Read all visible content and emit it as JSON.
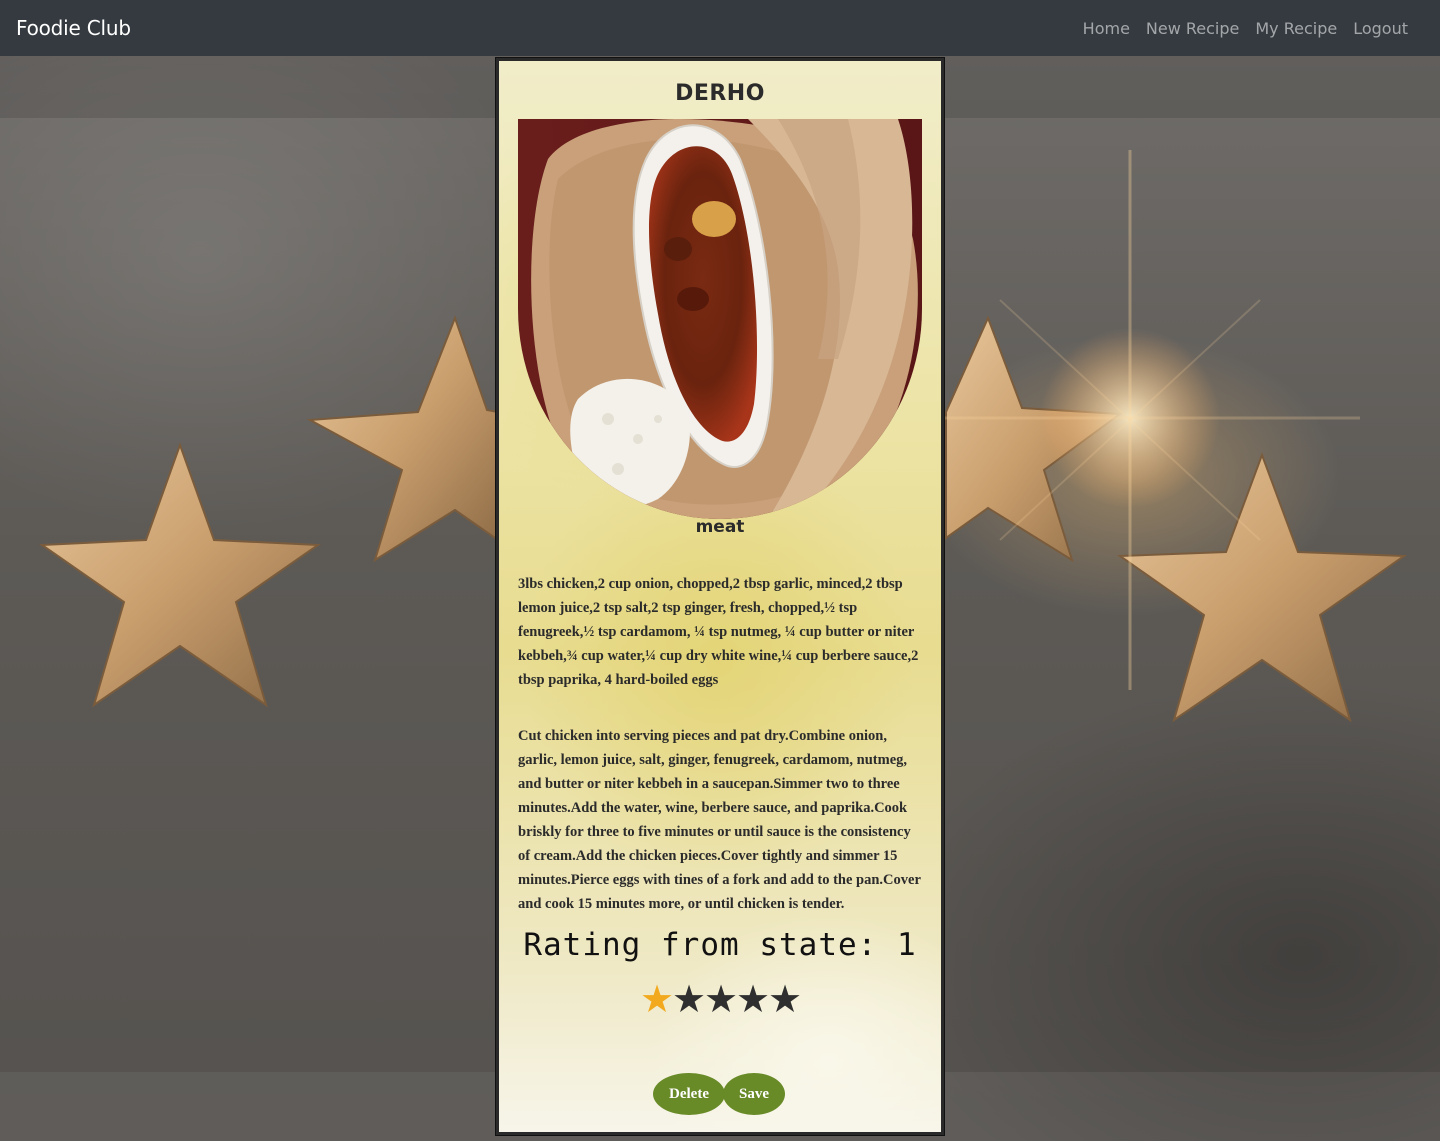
{
  "navbar": {
    "brand": "Foodie Club",
    "links": [
      "Home",
      "New Recipe",
      "My Recipe",
      "Logout"
    ]
  },
  "recipe": {
    "title": "DERHO",
    "category": "meat",
    "ingredients": "3lbs chicken,2 cup onion, chopped,2 tbsp garlic, minced,2 tbsp lemon juice,2 tsp salt,2 tsp ginger, fresh, chopped,½ tsp fenugreek,½ tsp cardamom, ¼ tsp nutmeg, ¼ cup butter or niter kebbeh,¾ cup water,¼ cup dry white wine,¼ cup berbere sauce,2 tbsp paprika, 4 hard-boiled eggs",
    "instructions": "Cut chicken into serving pieces and pat dry.Combine onion, garlic, lemon juice, salt, ginger, fenugreek, cardamom, nutmeg, and butter or niter kebbeh in a saucepan.Simmer two to three minutes.Add the water, wine, berbere sauce, and paprika.Cook briskly for three to five minutes or until sauce is the consistency of cream.Add the chicken pieces.Cover tightly and simmer 15 minutes.Pierce eggs with tines of a fork and add to the pan.Cover and cook 15 minutes more, or until chicken is tender."
  },
  "rating": {
    "label": "Rating from state: 1",
    "value": 1,
    "max": 5,
    "star_glyph": "★",
    "filled_color": "#f2a91e",
    "empty_color": "#2f2f2f"
  },
  "actions": {
    "delete_label": "Delete",
    "save_label": "Save"
  },
  "colors": {
    "navbar_bg": "#343a40",
    "button_bg": "#688a27"
  }
}
